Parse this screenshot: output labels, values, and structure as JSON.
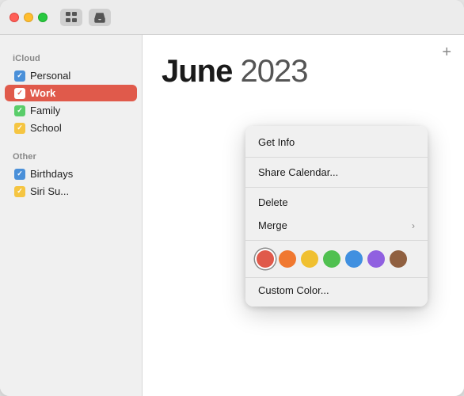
{
  "titlebar": {
    "icons": [
      "grid-icon",
      "inbox-icon"
    ]
  },
  "sidebar": {
    "icloud_label": "iCloud",
    "other_label": "Other",
    "items_icloud": [
      {
        "id": "personal",
        "label": "Personal",
        "color": "blue",
        "checked": true,
        "active": false
      },
      {
        "id": "work",
        "label": "Work",
        "color": "red",
        "checked": true,
        "active": true
      },
      {
        "id": "family",
        "label": "Family",
        "color": "green",
        "checked": true,
        "active": false
      },
      {
        "id": "school",
        "label": "School",
        "color": "yellow",
        "checked": true,
        "active": false
      }
    ],
    "items_other": [
      {
        "id": "birthdays",
        "label": "Birthdays",
        "color": "blue",
        "checked": true,
        "active": false
      },
      {
        "id": "siri-suggestions",
        "label": "Siri Su...",
        "color": "yellow",
        "checked": true,
        "active": false
      }
    ]
  },
  "main": {
    "add_button": "+",
    "month": "June",
    "year": "2023"
  },
  "context_menu": {
    "items": [
      {
        "id": "get-info",
        "label": "Get Info",
        "has_submenu": false
      },
      {
        "id": "share-calendar",
        "label": "Share Calendar...",
        "has_submenu": false
      },
      {
        "id": "delete",
        "label": "Delete",
        "has_submenu": false
      },
      {
        "id": "merge",
        "label": "Merge",
        "has_submenu": true
      }
    ],
    "colors": [
      {
        "id": "red",
        "label": "Red",
        "selected": true
      },
      {
        "id": "orange",
        "label": "Orange",
        "selected": false
      },
      {
        "id": "yellow",
        "label": "Yellow",
        "selected": false
      },
      {
        "id": "green",
        "label": "Green",
        "selected": false
      },
      {
        "id": "blue",
        "label": "Blue",
        "selected": false
      },
      {
        "id": "purple",
        "label": "Purple",
        "selected": false
      },
      {
        "id": "brown",
        "label": "Brown",
        "selected": false
      }
    ],
    "custom_color_label": "Custom Color..."
  }
}
